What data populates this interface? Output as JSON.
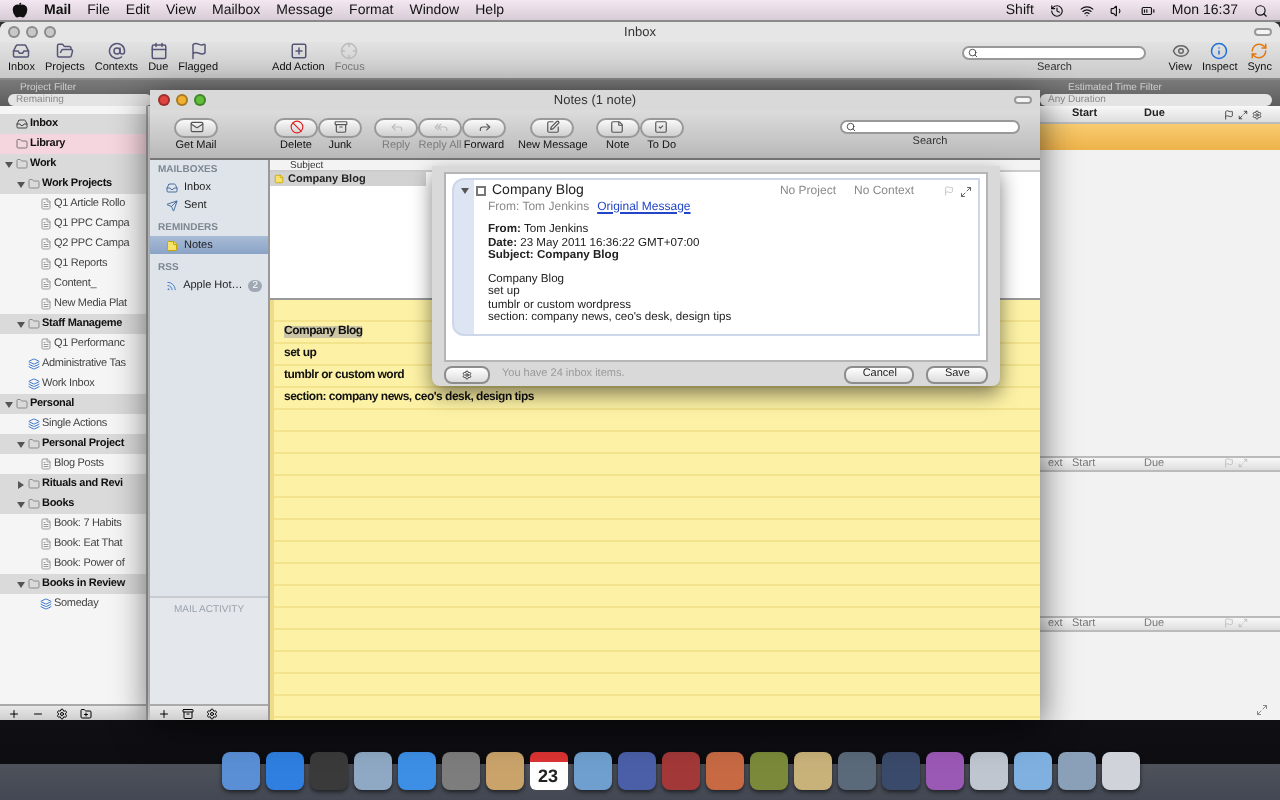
{
  "menubar": {
    "app": "Mail",
    "menus": [
      "File",
      "Edit",
      "View",
      "Mailbox",
      "Message",
      "Format",
      "Window",
      "Help"
    ],
    "input_source": "Shift",
    "clock": "Mon 16:37"
  },
  "back_window": {
    "title": "Inbox",
    "toolbar": [
      {
        "label": "Inbox",
        "disabled": false
      },
      {
        "label": "Projects",
        "disabled": false
      },
      {
        "label": "Contexts",
        "disabled": false
      },
      {
        "label": "Due",
        "disabled": false
      },
      {
        "label": "Flagged",
        "disabled": false
      },
      {
        "label": "Add Action",
        "disabled": false
      },
      {
        "label": "Focus",
        "disabled": true
      }
    ],
    "search_label": "Search",
    "right_tools": [
      "View",
      "Inspect",
      "Sync"
    ],
    "filters": [
      {
        "title": "Project Filter",
        "value": "Remaining"
      },
      {
        "title": "Estimated Time Filter",
        "value": "Any Duration"
      }
    ],
    "sidebar": [
      {
        "label": "Inbox",
        "kind": "inbox",
        "selected": false
      },
      {
        "label": "Library",
        "kind": "library",
        "selected": true
      },
      {
        "label": "Work",
        "kind": "folder",
        "selected": false,
        "expanded": true,
        "children": [
          {
            "label": "Work Projects",
            "kind": "folder",
            "selected": false,
            "expanded": true,
            "children": [
              {
                "label": "Q1 Article Rollo",
                "kind": "project",
                "selected": false
              },
              {
                "label": "Q1 PPC Campa",
                "kind": "project",
                "selected": false
              },
              {
                "label": "Q2 PPC Campa",
                "kind": "project",
                "selected": false
              },
              {
                "label": "Q1 Reports",
                "kind": "project",
                "selected": false
              },
              {
                "label": "Content_",
                "kind": "project",
                "selected": false
              },
              {
                "label": "New Media Plat",
                "kind": "project",
                "selected": false
              }
            ]
          },
          {
            "label": "Staff Manageme",
            "kind": "folder",
            "selected": false,
            "expanded": true,
            "children": [
              {
                "label": "Q1 Performanc",
                "kind": "project",
                "selected": false
              }
            ]
          },
          {
            "label": "Administrative Tas",
            "kind": "list",
            "selected": false
          },
          {
            "label": "Work Inbox",
            "kind": "list",
            "selected": false
          }
        ]
      },
      {
        "label": "Personal",
        "kind": "folder",
        "selected": false,
        "expanded": true,
        "children": [
          {
            "label": "Single Actions",
            "kind": "list",
            "selected": false
          },
          {
            "label": "Personal Project",
            "kind": "folder",
            "selected": false,
            "expanded": true,
            "children": [
              {
                "label": "Blog Posts",
                "kind": "project",
                "selected": false
              }
            ]
          },
          {
            "label": "Rituals and Revi",
            "kind": "folder",
            "selected": false,
            "expanded": false
          },
          {
            "label": "Books",
            "kind": "folder",
            "selected": false,
            "expanded": true,
            "children": [
              {
                "label": "Book: 7 Habits",
                "kind": "project",
                "selected": false
              },
              {
                "label": "Book: Eat That",
                "kind": "project",
                "selected": false
              },
              {
                "label": "Book: Power of",
                "kind": "project",
                "selected": false
              }
            ]
          },
          {
            "label": "Books in Review",
            "kind": "folder",
            "selected": false,
            "expanded": true,
            "children": [
              {
                "label": "Someday",
                "kind": "list",
                "selected": false
              }
            ]
          }
        ]
      }
    ],
    "columns": [
      "Start",
      "Due"
    ],
    "rows": [
      {
        "selected": true
      }
    ],
    "lower_panes": [
      {
        "columns": [
          "ext",
          "Start",
          "Due"
        ]
      },
      {
        "columns": [
          "ext",
          "Start",
          "Due"
        ]
      }
    ]
  },
  "mail_window": {
    "title": "Notes (1 note)",
    "toolbar": [
      {
        "label": "Get Mail",
        "disabled": false
      },
      {
        "label": "Delete",
        "disabled": false
      },
      {
        "label": "Junk",
        "disabled": false
      },
      {
        "label": "Reply",
        "disabled": true
      },
      {
        "label": "Reply All",
        "disabled": true
      },
      {
        "label": "Forward",
        "disabled": false
      },
      {
        "label": "New Message",
        "disabled": false
      },
      {
        "label": "Note",
        "disabled": false
      },
      {
        "label": "To Do",
        "disabled": false
      }
    ],
    "search_label": "Search",
    "sidebar": [
      {
        "heading": "MAILBOXES",
        "items": [
          {
            "label": "Inbox",
            "kind": "inbox",
            "selected": false
          },
          {
            "label": "Sent",
            "kind": "sent",
            "selected": false
          }
        ]
      },
      {
        "heading": "REMINDERS",
        "items": [
          {
            "label": "Notes",
            "kind": "notes",
            "selected": true
          }
        ]
      },
      {
        "heading": "RSS",
        "items": [
          {
            "label": "Apple Hot…",
            "kind": "rss",
            "selected": false,
            "badge": "2"
          }
        ]
      }
    ],
    "activity_heading": "MAIL ACTIVITY",
    "list_header": "Subject",
    "messages": [
      {
        "subject": "Company Blog",
        "selected": true
      }
    ],
    "note_lines": [
      {
        "text": "Company Blog",
        "selected": true
      },
      {
        "text": "set up",
        "selected": false
      },
      {
        "text": "tumblr or custom word",
        "selected": false
      },
      {
        "text": "section: company news, ceo's desk, design tips",
        "selected": false
      }
    ]
  },
  "sheet": {
    "expanded": true,
    "checked": false,
    "task": "Company Blog",
    "project": "No Project",
    "context": "No Context",
    "from": "From: Tom Jenkins",
    "link": "Original Message",
    "headers": [
      {
        "text": "**From:** Tom Jenkins",
        "bold": false
      },
      {
        "text": "**Date:** 23 May 2011 16:36:22 GMT+07:00",
        "bold": false
      },
      {
        "text": "Subject: Company Blog",
        "bold": true
      }
    ],
    "body": [
      "Company Blog",
      "set up",
      "tumblr or custom wordpress",
      "section: company news, ceo's desk, design tips"
    ],
    "status": "You have 24 inbox items.",
    "buttons": [
      "Cancel",
      "Save"
    ]
  },
  "dock": {
    "calendar_day": "23"
  }
}
